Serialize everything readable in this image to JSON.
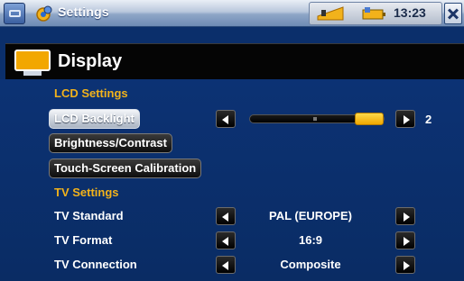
{
  "statusbar": {
    "app_title": "Settings",
    "clock": "13:23"
  },
  "header": {
    "title": "Display"
  },
  "lcd_section": {
    "title": "LCD Settings",
    "backlight_label": "LCD Backlight",
    "backlight_value": "2",
    "backlight_level": 1.0,
    "brightness_label": "Brightness/Contrast",
    "calibration_label": "Touch-Screen Calibration"
  },
  "tv_section": {
    "title": "TV Settings",
    "rows": [
      {
        "label": "TV Standard",
        "value": "PAL (EUROPE)"
      },
      {
        "label": "TV Format",
        "value": "16:9"
      },
      {
        "label": "TV Connection",
        "value": "Composite"
      }
    ]
  },
  "colors": {
    "accent": "#f2b21b",
    "background": "#0b2f6b",
    "header_bg": "#050505"
  },
  "icons": [
    "menu-icon",
    "gear-icon",
    "volume-icon",
    "battery-icon",
    "close-icon",
    "display-icon",
    "arrow-left-icon",
    "arrow-right-icon"
  ]
}
